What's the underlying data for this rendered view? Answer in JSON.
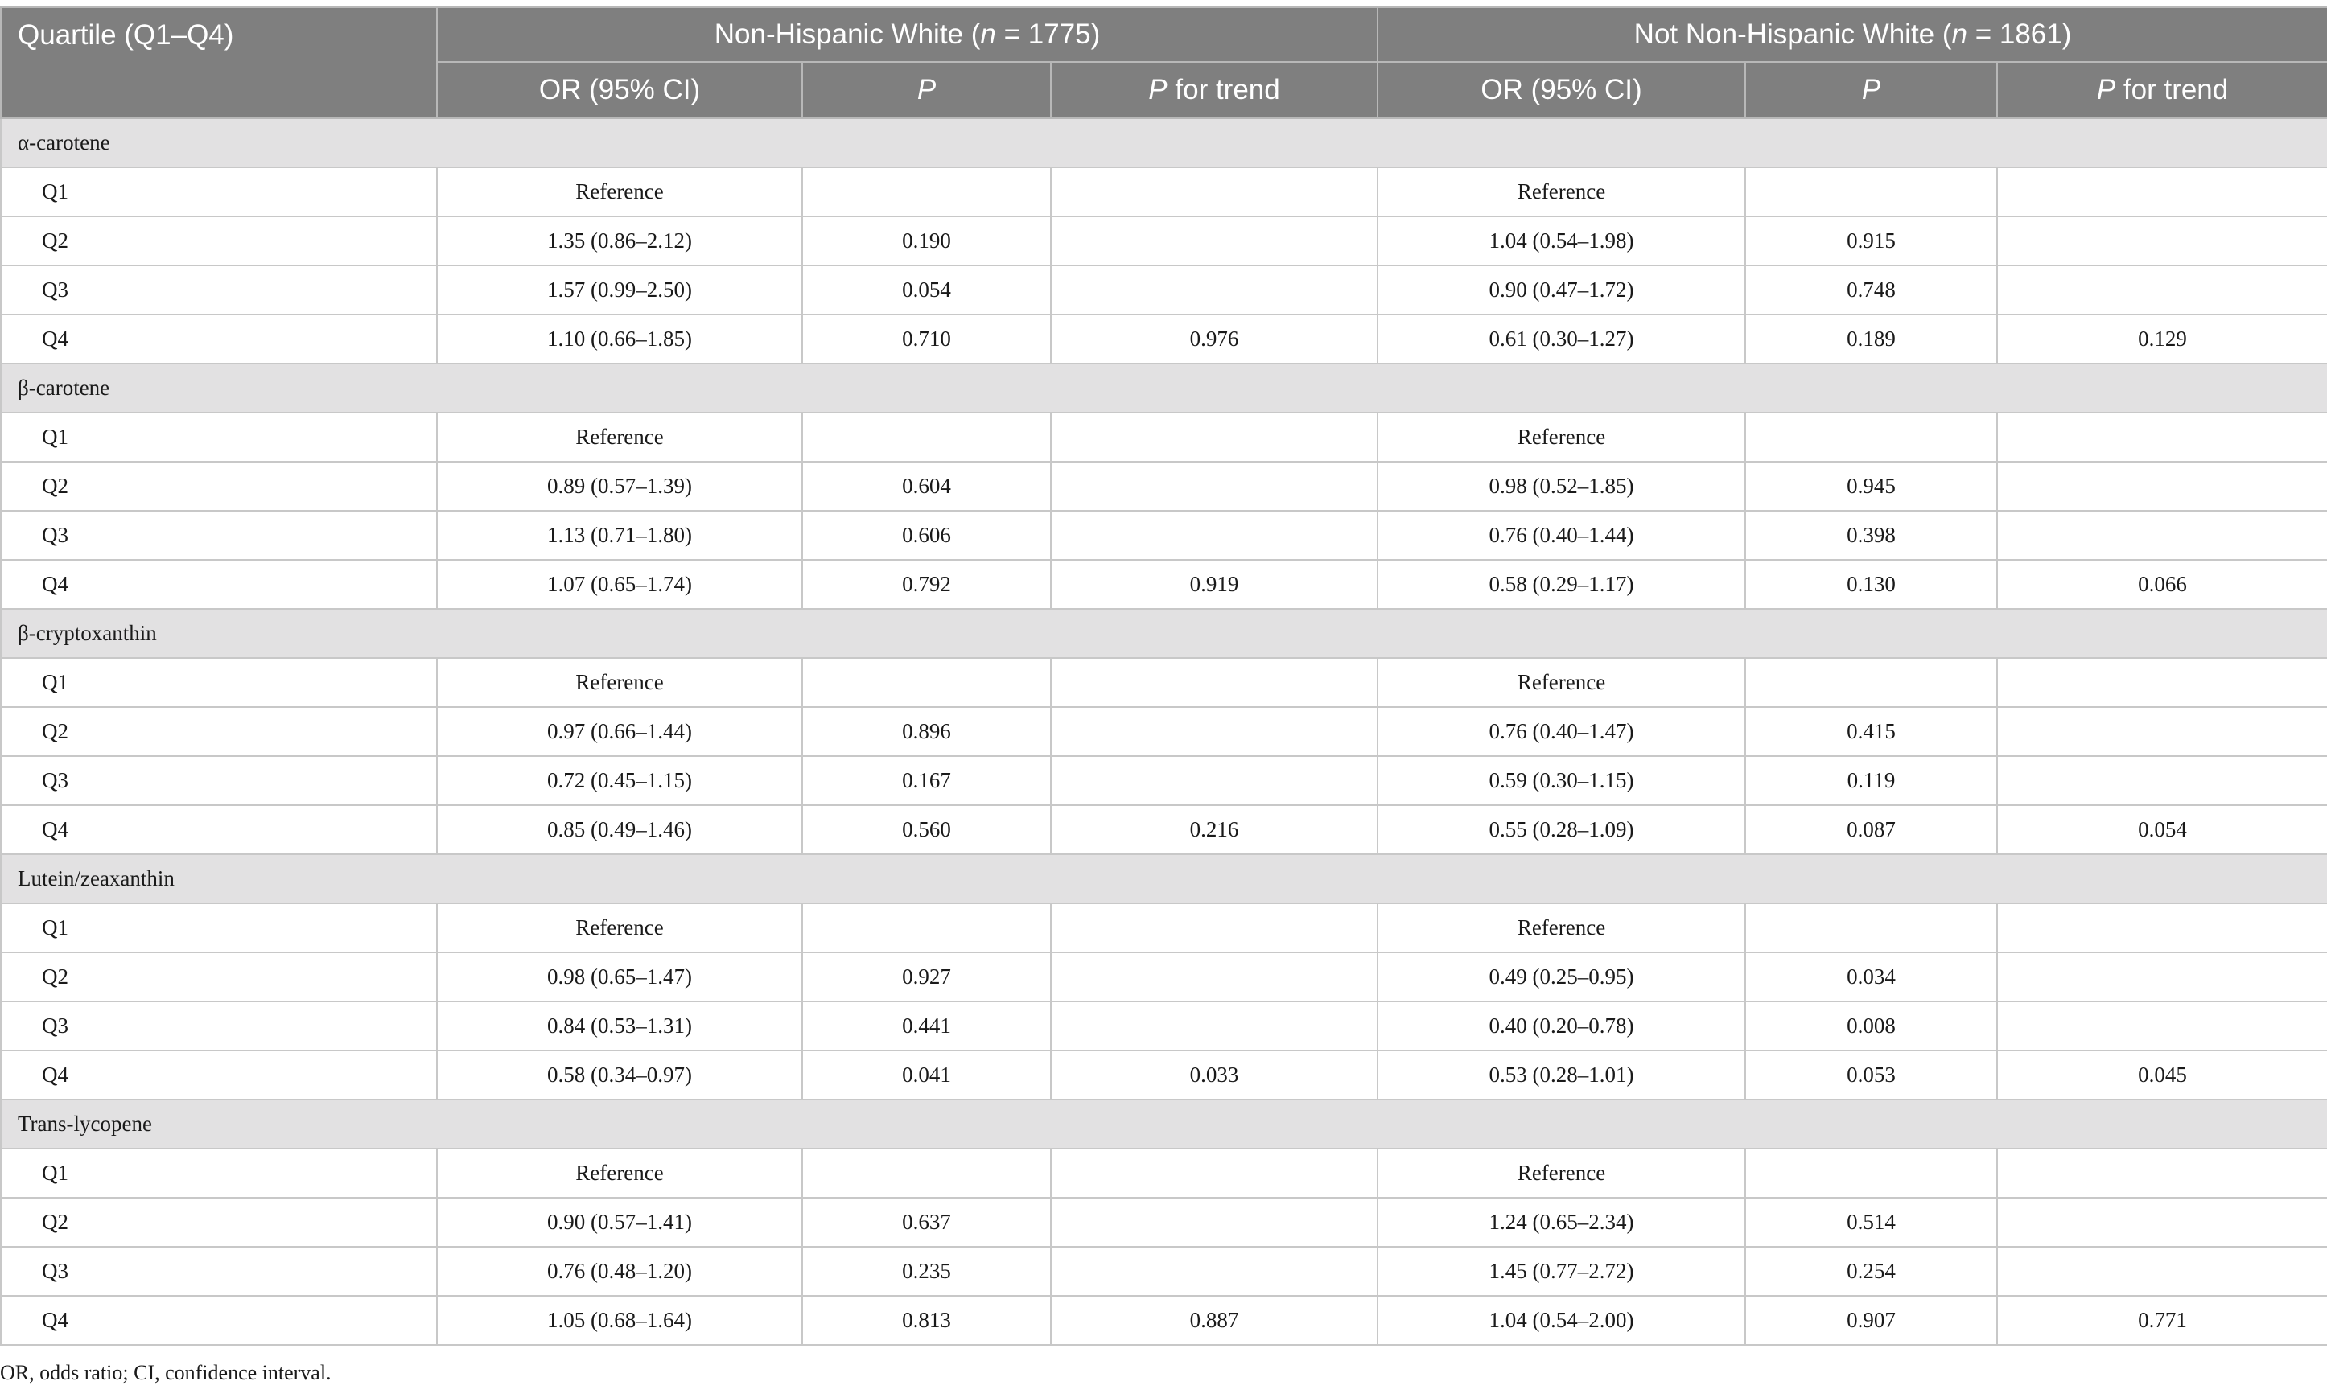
{
  "header": {
    "quartile": "Quartile (Q1–Q4)",
    "group_a": {
      "prefix": "Non-Hispanic White (",
      "n_label": "n",
      "suffix": " = 1775)"
    },
    "group_b": {
      "prefix": "Not Non-Hispanic White (",
      "n_label": "n",
      "suffix": " = 1861)"
    },
    "or_ci": "OR (95% CI)",
    "p": "P",
    "p_trend_p": "P",
    "p_trend_rest": " for trend"
  },
  "groups": [
    {
      "name": "α-carotene",
      "rows": [
        {
          "q": "Q1",
          "or_a": "Reference",
          "p_a": "",
          "t_a": "",
          "or_b": "Reference",
          "p_b": "",
          "t_b": ""
        },
        {
          "q": "Q2",
          "or_a": "1.35 (0.86–2.12)",
          "p_a": "0.190",
          "t_a": "",
          "or_b": "1.04 (0.54–1.98)",
          "p_b": "0.915",
          "t_b": ""
        },
        {
          "q": "Q3",
          "or_a": "1.57 (0.99–2.50)",
          "p_a": "0.054",
          "t_a": "",
          "or_b": "0.90 (0.47–1.72)",
          "p_b": "0.748",
          "t_b": ""
        },
        {
          "q": "Q4",
          "or_a": "1.10 (0.66–1.85)",
          "p_a": "0.710",
          "t_a": "0.976",
          "or_b": "0.61 (0.30–1.27)",
          "p_b": "0.189",
          "t_b": "0.129"
        }
      ]
    },
    {
      "name": "β-carotene",
      "rows": [
        {
          "q": "Q1",
          "or_a": "Reference",
          "p_a": "",
          "t_a": "",
          "or_b": "Reference",
          "p_b": "",
          "t_b": ""
        },
        {
          "q": "Q2",
          "or_a": "0.89 (0.57–1.39)",
          "p_a": "0.604",
          "t_a": "",
          "or_b": "0.98 (0.52–1.85)",
          "p_b": "0.945",
          "t_b": ""
        },
        {
          "q": "Q3",
          "or_a": "1.13 (0.71–1.80)",
          "p_a": "0.606",
          "t_a": "",
          "or_b": "0.76 (0.40–1.44)",
          "p_b": "0.398",
          "t_b": ""
        },
        {
          "q": "Q4",
          "or_a": "1.07 (0.65–1.74)",
          "p_a": "0.792",
          "t_a": "0.919",
          "or_b": "0.58 (0.29–1.17)",
          "p_b": "0.130",
          "t_b": "0.066"
        }
      ]
    },
    {
      "name": "β-cryptoxanthin",
      "rows": [
        {
          "q": "Q1",
          "or_a": "Reference",
          "p_a": "",
          "t_a": "",
          "or_b": "Reference",
          "p_b": "",
          "t_b": ""
        },
        {
          "q": "Q2",
          "or_a": "0.97 (0.66–1.44)",
          "p_a": "0.896",
          "t_a": "",
          "or_b": "0.76 (0.40–1.47)",
          "p_b": "0.415",
          "t_b": ""
        },
        {
          "q": "Q3",
          "or_a": "0.72 (0.45–1.15)",
          "p_a": "0.167",
          "t_a": "",
          "or_b": "0.59 (0.30–1.15)",
          "p_b": "0.119",
          "t_b": ""
        },
        {
          "q": "Q4",
          "or_a": "0.85 (0.49–1.46)",
          "p_a": "0.560",
          "t_a": "0.216",
          "or_b": "0.55 (0.28–1.09)",
          "p_b": "0.087",
          "t_b": "0.054"
        }
      ]
    },
    {
      "name": "Lutein/zeaxanthin",
      "rows": [
        {
          "q": "Q1",
          "or_a": "Reference",
          "p_a": "",
          "t_a": "",
          "or_b": "Reference",
          "p_b": "",
          "t_b": ""
        },
        {
          "q": "Q2",
          "or_a": "0.98 (0.65–1.47)",
          "p_a": "0.927",
          "t_a": "",
          "or_b": "0.49 (0.25–0.95)",
          "p_b": "0.034",
          "t_b": ""
        },
        {
          "q": "Q3",
          "or_a": "0.84 (0.53–1.31)",
          "p_a": "0.441",
          "t_a": "",
          "or_b": "0.40 (0.20–0.78)",
          "p_b": "0.008",
          "t_b": ""
        },
        {
          "q": "Q4",
          "or_a": "0.58 (0.34–0.97)",
          "p_a": "0.041",
          "t_a": "0.033",
          "or_b": "0.53 (0.28–1.01)",
          "p_b": "0.053",
          "t_b": "0.045"
        }
      ]
    },
    {
      "name": "Trans-lycopene",
      "rows": [
        {
          "q": "Q1",
          "or_a": "Reference",
          "p_a": "",
          "t_a": "",
          "or_b": "Reference",
          "p_b": "",
          "t_b": ""
        },
        {
          "q": "Q2",
          "or_a": "0.90 (0.57–1.41)",
          "p_a": "0.637",
          "t_a": "",
          "or_b": "1.24 (0.65–2.34)",
          "p_b": "0.514",
          "t_b": ""
        },
        {
          "q": "Q3",
          "or_a": "0.76 (0.48–1.20)",
          "p_a": "0.235",
          "t_a": "",
          "or_b": "1.45 (0.77–2.72)",
          "p_b": "0.254",
          "t_b": ""
        },
        {
          "q": "Q4",
          "or_a": "1.05 (0.68–1.64)",
          "p_a": "0.813",
          "t_a": "0.887",
          "or_b": "1.04 (0.54–2.00)",
          "p_b": "0.907",
          "t_b": "0.771"
        }
      ]
    }
  ],
  "footnote": "OR, odds ratio; CI, confidence interval.",
  "colors": {
    "header_bg": "#7f7f7f",
    "group_row_bg": "#e2e1e2",
    "grid": "#c8c8c8"
  }
}
